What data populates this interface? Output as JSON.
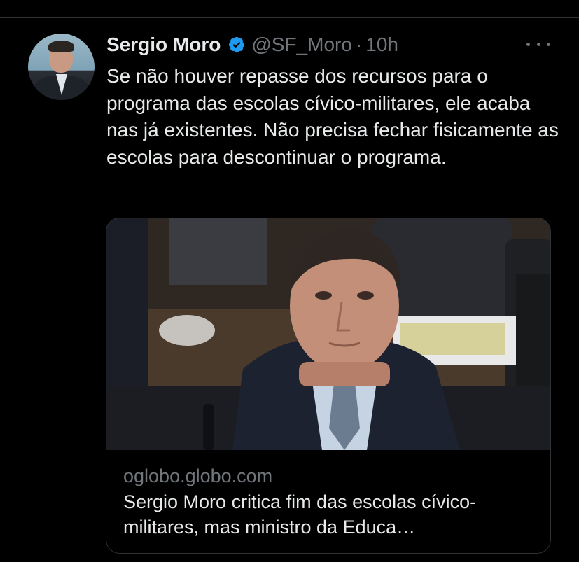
{
  "author": {
    "name": "Sergio Moro",
    "handle": "@SF_Moro",
    "time": "10h",
    "verified": true
  },
  "tweet": {
    "text": "Se não houver repasse dos recursos para o programa das escolas cívico-militares, ele acaba nas já existentes. Não precisa fechar fisicamente as escolas para descontinuar o programa."
  },
  "link_card": {
    "domain": "oglobo.globo.com",
    "title": "Sergio Moro critica fim das escolas cívico-militares, mas ministro da Educa…"
  },
  "colors": {
    "background": "#000000",
    "text_primary": "#e7e9ea",
    "text_secondary": "#71767b",
    "verified_badge": "#1d9bf0",
    "border": "#2f3336"
  },
  "icons": {
    "verified": "verified-badge-icon",
    "more": "more-options-icon"
  }
}
